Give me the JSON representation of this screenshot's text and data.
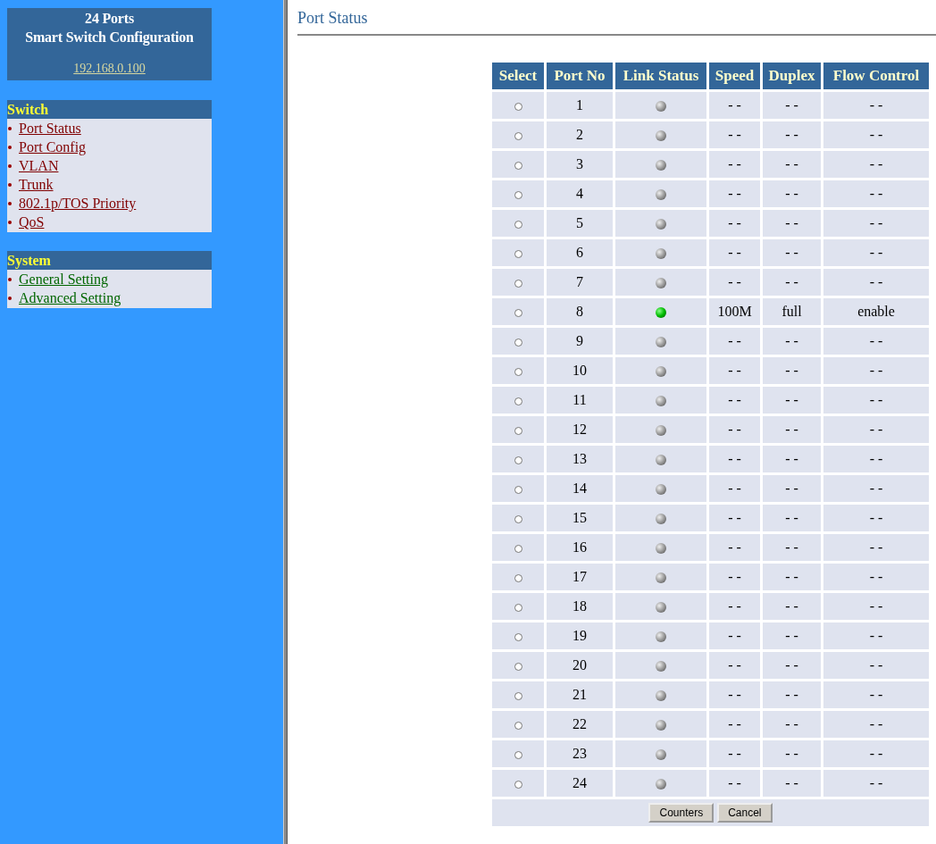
{
  "sidebar": {
    "title_lines": [
      "24 Ports",
      "Smart Switch Configuration"
    ],
    "address": "192.168.0.100",
    "sections": [
      {
        "heading": "Switch",
        "kind": "switch",
        "items": [
          "Port Status",
          "Port Config",
          "VLAN",
          "Trunk",
          "802.1p/TOS Priority",
          "QoS"
        ]
      },
      {
        "heading": "System",
        "kind": "system",
        "items": [
          "General Setting",
          "Advanced Setting"
        ]
      }
    ]
  },
  "page_title": "Port Status",
  "table": {
    "columns": [
      "Select",
      "Port No",
      "Link Status",
      "Speed",
      "Duplex",
      "Flow Control"
    ],
    "rows": [
      {
        "selected": false,
        "port": "1",
        "link_up": false,
        "speed": "- -",
        "duplex": "- -",
        "flow_control": "- -"
      },
      {
        "selected": false,
        "port": "2",
        "link_up": false,
        "speed": "- -",
        "duplex": "- -",
        "flow_control": "- -"
      },
      {
        "selected": false,
        "port": "3",
        "link_up": false,
        "speed": "- -",
        "duplex": "- -",
        "flow_control": "- -"
      },
      {
        "selected": false,
        "port": "4",
        "link_up": false,
        "speed": "- -",
        "duplex": "- -",
        "flow_control": "- -"
      },
      {
        "selected": false,
        "port": "5",
        "link_up": false,
        "speed": "- -",
        "duplex": "- -",
        "flow_control": "- -"
      },
      {
        "selected": false,
        "port": "6",
        "link_up": false,
        "speed": "- -",
        "duplex": "- -",
        "flow_control": "- -"
      },
      {
        "selected": false,
        "port": "7",
        "link_up": false,
        "speed": "- -",
        "duplex": "- -",
        "flow_control": "- -"
      },
      {
        "selected": false,
        "port": "8",
        "link_up": true,
        "speed": "100M",
        "duplex": "full",
        "flow_control": "enable"
      },
      {
        "selected": false,
        "port": "9",
        "link_up": false,
        "speed": "- -",
        "duplex": "- -",
        "flow_control": "- -"
      },
      {
        "selected": false,
        "port": "10",
        "link_up": false,
        "speed": "- -",
        "duplex": "- -",
        "flow_control": "- -"
      },
      {
        "selected": false,
        "port": "11",
        "link_up": false,
        "speed": "- -",
        "duplex": "- -",
        "flow_control": "- -"
      },
      {
        "selected": false,
        "port": "12",
        "link_up": false,
        "speed": "- -",
        "duplex": "- -",
        "flow_control": "- -"
      },
      {
        "selected": false,
        "port": "13",
        "link_up": false,
        "speed": "- -",
        "duplex": "- -",
        "flow_control": "- -"
      },
      {
        "selected": false,
        "port": "14",
        "link_up": false,
        "speed": "- -",
        "duplex": "- -",
        "flow_control": "- -"
      },
      {
        "selected": false,
        "port": "15",
        "link_up": false,
        "speed": "- -",
        "duplex": "- -",
        "flow_control": "- -"
      },
      {
        "selected": false,
        "port": "16",
        "link_up": false,
        "speed": "- -",
        "duplex": "- -",
        "flow_control": "- -"
      },
      {
        "selected": false,
        "port": "17",
        "link_up": false,
        "speed": "- -",
        "duplex": "- -",
        "flow_control": "- -"
      },
      {
        "selected": false,
        "port": "18",
        "link_up": false,
        "speed": "- -",
        "duplex": "- -",
        "flow_control": "- -"
      },
      {
        "selected": false,
        "port": "19",
        "link_up": false,
        "speed": "- -",
        "duplex": "- -",
        "flow_control": "- -"
      },
      {
        "selected": false,
        "port": "20",
        "link_up": false,
        "speed": "- -",
        "duplex": "- -",
        "flow_control": "- -"
      },
      {
        "selected": false,
        "port": "21",
        "link_up": false,
        "speed": "- -",
        "duplex": "- -",
        "flow_control": "- -"
      },
      {
        "selected": false,
        "port": "22",
        "link_up": false,
        "speed": "- -",
        "duplex": "- -",
        "flow_control": "- -"
      },
      {
        "selected": false,
        "port": "23",
        "link_up": false,
        "speed": "- -",
        "duplex": "- -",
        "flow_control": "- -"
      },
      {
        "selected": false,
        "port": "24",
        "link_up": false,
        "speed": "- -",
        "duplex": "- -",
        "flow_control": "- -"
      }
    ]
  },
  "buttons": [
    "Counters",
    "Cancel"
  ]
}
